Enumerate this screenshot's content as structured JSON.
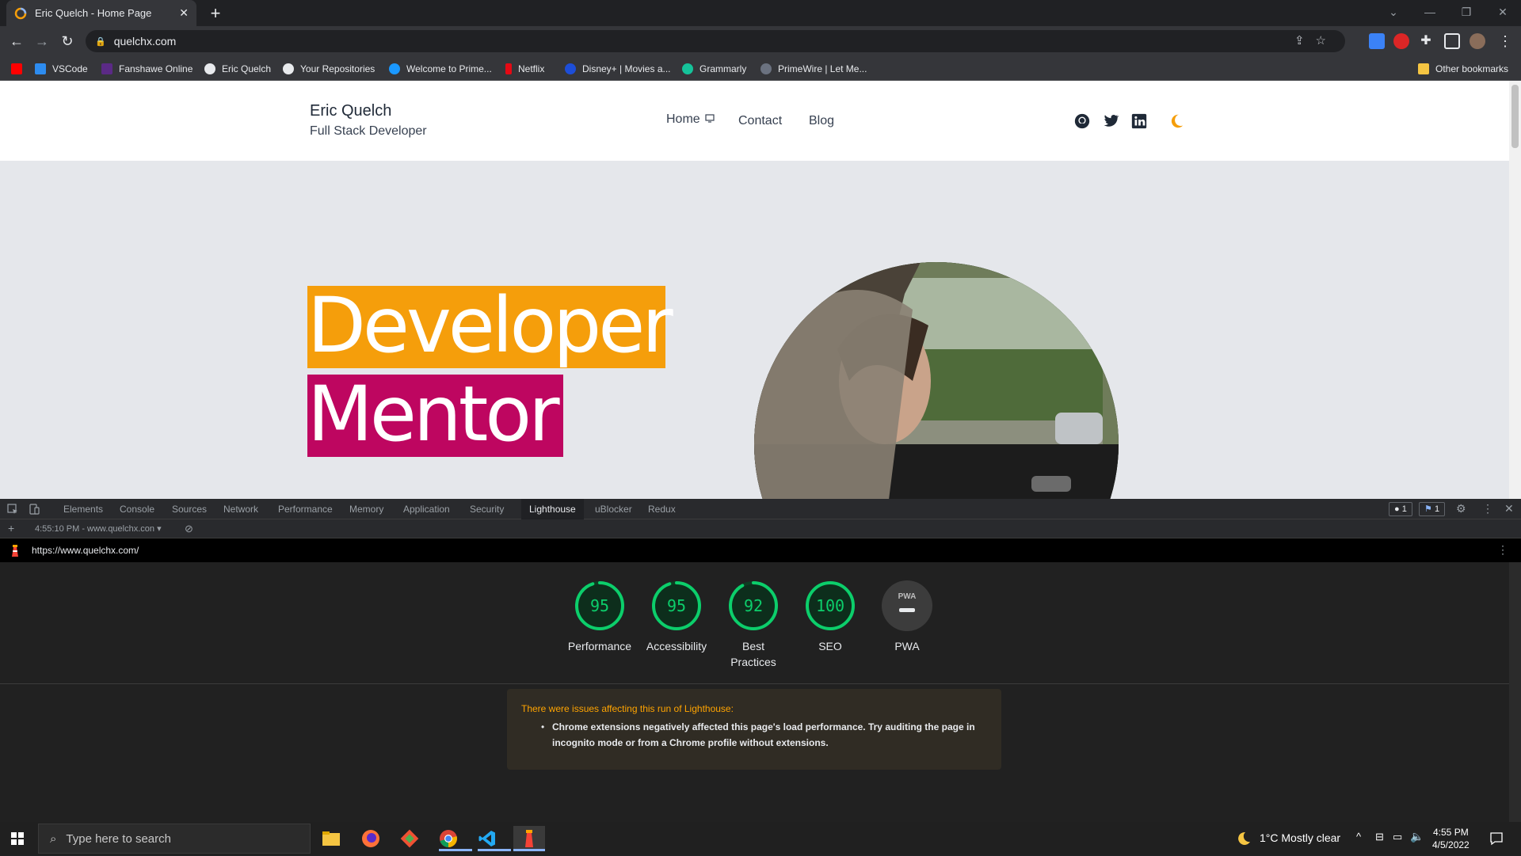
{
  "browser": {
    "tab": {
      "title": "Eric Quelch - Home Page",
      "close": "✕"
    },
    "new_tab": "+",
    "window_controls": {
      "dropdown": "⌄",
      "minimize": "—",
      "restore": "❐",
      "close": "✕"
    },
    "address": "quelchx.com",
    "bookmarks": [
      {
        "label": "",
        "icon": "youtube-icon",
        "color": "#ff0000"
      },
      {
        "label": "VSCode",
        "icon": "vscode-icon",
        "color": "#2d8cf0"
      },
      {
        "label": "Fanshawe Online",
        "icon": "fanshawe-icon",
        "color": "#5b2a86"
      },
      {
        "label": "Eric Quelch",
        "icon": "github-icon",
        "color": "#e8eaed"
      },
      {
        "label": "Your Repositories",
        "icon": "github-icon",
        "color": "#e8eaed"
      },
      {
        "label": "Welcome to Prime...",
        "icon": "prime-icon",
        "color": "#1a98ff"
      },
      {
        "label": "Netflix",
        "icon": "netflix-icon",
        "color": "#e50914"
      },
      {
        "label": "Disney+ | Movies a...",
        "icon": "disney-icon",
        "color": "#1d4ed8"
      },
      {
        "label": "Grammarly",
        "icon": "grammarly-icon",
        "color": "#15c39a"
      },
      {
        "label": "PrimeWire | Let Me...",
        "icon": "primewire-icon",
        "color": "#6b7280"
      }
    ],
    "other_bookmarks": "Other bookmarks"
  },
  "site": {
    "brand_name": "Eric Quelch",
    "brand_sub": "Full Stack Developer",
    "nav": {
      "home": "Home",
      "contact": "Contact",
      "blog": "Blog"
    },
    "hero_words": [
      "Developer",
      "Mentor"
    ],
    "colors": {
      "developer_bg": "#f59e0b",
      "mentor_bg": "#be0660",
      "moon": "#f59e0b"
    }
  },
  "devtools": {
    "tabs": [
      "Elements",
      "Console",
      "Sources",
      "Network",
      "Performance",
      "Memory",
      "Application",
      "Security",
      "Lighthouse",
      "uBlocker",
      "Redux"
    ],
    "active_tab": "Lighthouse",
    "badges": {
      "issues": "1",
      "messages": "1"
    },
    "report_time": "4:55:10 PM - www.quelchx.con",
    "report_url": "https://www.quelchx.com/",
    "scores": [
      {
        "label": "Performance",
        "value": "95",
        "score": 95
      },
      {
        "label": "Accessibility",
        "value": "95",
        "score": 95
      },
      {
        "label": "Best Practices",
        "value": "92",
        "score": 92
      },
      {
        "label": "SEO",
        "value": "100",
        "score": 100
      },
      {
        "label": "PWA",
        "value": "PWA",
        "score": null
      }
    ],
    "warning_title": "There were issues affecting this run of Lighthouse:",
    "warning_item": "Chrome extensions negatively affected this page's load performance. Try auditing the page in incognito mode or from a Chrome profile without extensions."
  },
  "taskbar": {
    "search_placeholder": "Type here to search",
    "weather": "1°C  Mostly clear",
    "time": "4:55 PM",
    "date": "4/5/2022"
  }
}
